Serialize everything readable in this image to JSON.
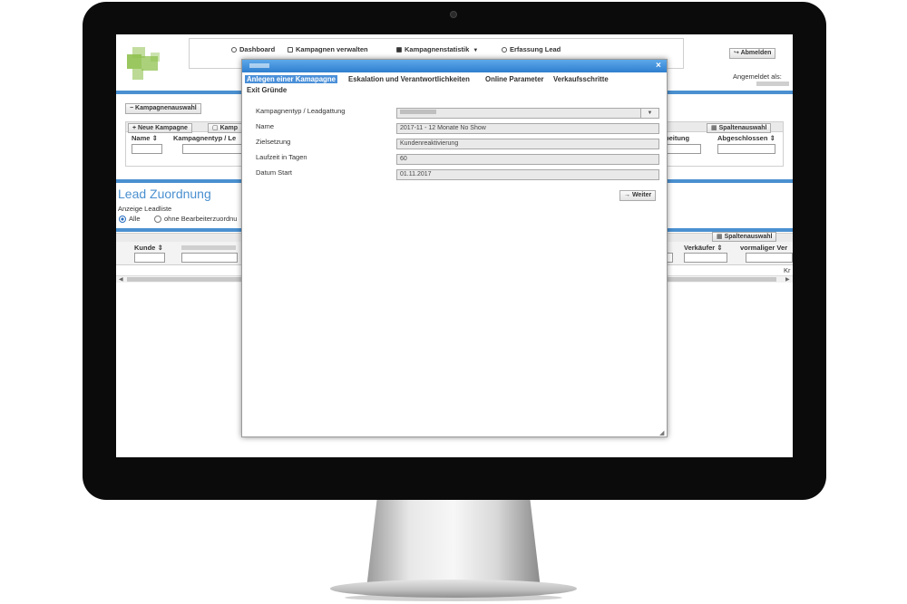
{
  "nav": {
    "items": [
      {
        "label": "Dashboard",
        "icon": "user-icon"
      },
      {
        "label": "Kampagnen verwalten",
        "icon": "cart-icon"
      },
      {
        "label": "Kampagnenstatistik",
        "icon": "camera-icon",
        "dropdown": true
      },
      {
        "label": "Erfassung Lead",
        "icon": "eye-icon"
      }
    ],
    "logout_label": "Abmelden",
    "logged_in_label": "Angemeldet als:"
  },
  "campaign_panel": {
    "toggle_label": "Kampagnenauswahl",
    "new_label": "Neue Kampagne",
    "tab2_label": "Kamp",
    "columns_button": "Spaltenauswahl",
    "columns": [
      "Name",
      "Kampagnentyp / Le",
      "beitung",
      "Abgeschlossen"
    ]
  },
  "lead": {
    "title": "Lead Zuordnung",
    "anzeige_label": "Anzeige Leadliste",
    "radio_all": "Alle",
    "radio_unassigned": "ohne Bearbeiterzuordnu",
    "columns_button": "Spaltenauswahl",
    "columns": [
      "Kunde",
      "Verkäufer",
      "vormaliger Ver"
    ],
    "right_cut": "Kr"
  },
  "modal": {
    "close_glyph": "×",
    "tabs": [
      {
        "label": "Anlegen einer Kamapagne",
        "active": true
      },
      {
        "label": "Eskalation und Verantwortlichkeiten",
        "active": false
      },
      {
        "label": "Online Parameter",
        "active": false
      },
      {
        "label": "Verkaufsschritte",
        "active": false
      },
      {
        "label": "Exit Gründe",
        "active": false
      }
    ],
    "fields": [
      {
        "label": "Kampagnentyp / Leadgattung",
        "value": ""
      },
      {
        "label": "Name",
        "value": "2017-11 - 12 Monate No Show"
      },
      {
        "label": "Zielsetzung",
        "value": "Kundenreaktivierung"
      },
      {
        "label": "Laufzeit in Tagen",
        "value": "60"
      },
      {
        "label": "Datum Start",
        "value": "01.11.2017"
      }
    ],
    "next_label": "Weiter"
  },
  "colors": {
    "accent": "#4a90d0",
    "logo_green": "#8fc14f"
  }
}
